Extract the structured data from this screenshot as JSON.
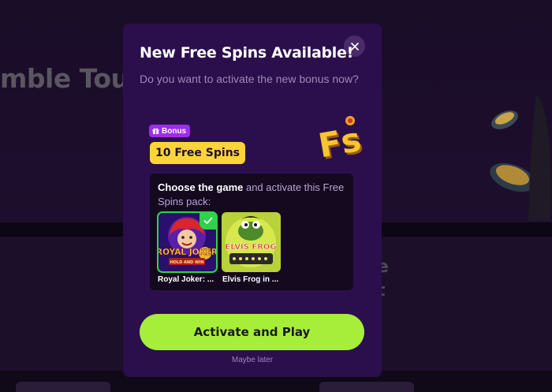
{
  "background": {
    "heading_fragment": "mble Tourn",
    "right_fragments": [
      "e",
      "t"
    ]
  },
  "modal": {
    "title": "New Free Spins Available!",
    "subtitle": "Do you want to activate the new bonus now?",
    "close_icon": "close-icon",
    "logo_text": "Fs",
    "bonus_badge": {
      "icon": "gift-icon",
      "label": "Bonus"
    },
    "spins_label": "10 Free Spins",
    "choose": {
      "strong": "Choose the game",
      "rest": " and activate this Free Spins pack:"
    },
    "games": [
      {
        "name": "Royal Joker: ...",
        "art_title": "ROYAL JOKER",
        "art_sub": "HOLD AND WIN",
        "selected": true
      },
      {
        "name": "Elvis Frog in ...",
        "art_title": "ELVIS FROG",
        "art_sub": "",
        "selected": false
      }
    ],
    "activate_label": "Activate and Play",
    "maybe_later_label": "Maybe later"
  },
  "colors": {
    "modal_bg": "#2b0f4d",
    "accent_green": "#a6ee3a",
    "pill_yellow": "#ffd43b",
    "badge_purple": "#9b2fe6",
    "check_green": "#2fd24a"
  }
}
